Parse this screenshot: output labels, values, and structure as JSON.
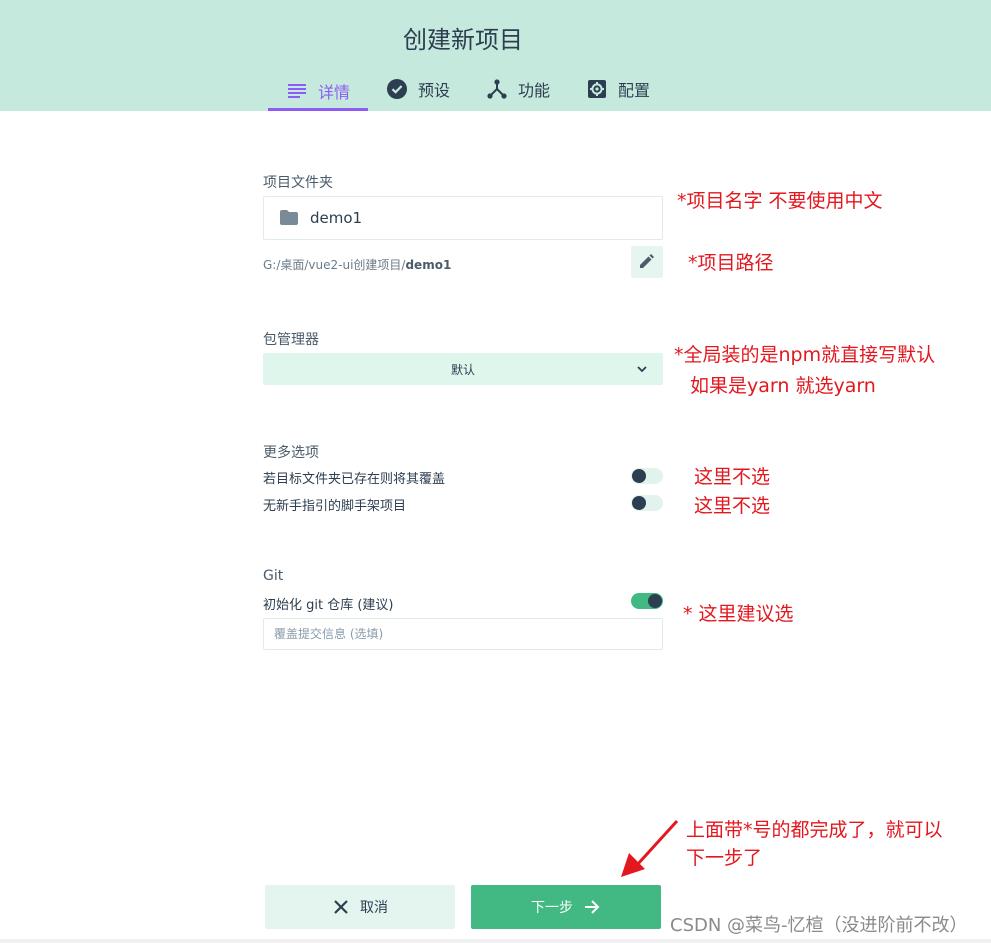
{
  "header": {
    "title": "创建新项目",
    "tabs": [
      {
        "label": "详情",
        "icon": "list-icon",
        "active": true
      },
      {
        "label": "预设",
        "icon": "check-circle-icon",
        "active": false
      },
      {
        "label": "功能",
        "icon": "branch-icon",
        "active": false
      },
      {
        "label": "配置",
        "icon": "gear-icon",
        "active": false
      }
    ]
  },
  "folder": {
    "label": "项目文件夹",
    "value": "demo1",
    "path_prefix": "G:/桌面/vue2-ui创建项目/",
    "path_name": "demo1"
  },
  "package_manager": {
    "label": "包管理器",
    "selected": "默认"
  },
  "more_options": {
    "label": "更多选项",
    "items": [
      {
        "label": "若目标文件夹已存在则将其覆盖",
        "enabled": false
      },
      {
        "label": "无新手指引的脚手架项目",
        "enabled": false
      }
    ]
  },
  "git": {
    "label": "Git",
    "init_label": "初始化 git 仓库 (建议)",
    "init_enabled": true,
    "commit_placeholder": "覆盖提交信息 (选填)"
  },
  "annotations": {
    "name_note": "*项目名字 不要使用中文",
    "path_note": "*项目路径",
    "pm_note_1": "*全局装的是npm就直接写默认",
    "pm_note_2": "如果是yarn 就选yarn",
    "opt1_note": "这里不选",
    "opt2_note": "这里不选",
    "git_note": "* 这里建议选",
    "final_note_1": "上面带*号的都完成了，就可以",
    "final_note_2": "下一步了"
  },
  "buttons": {
    "cancel": "取消",
    "next": "下一步"
  },
  "watermark": "CSDN @菜鸟-忆楦（没进阶前不改）",
  "colors": {
    "header_bg": "#c6e9dd",
    "accent_purple": "#8d5cf6",
    "primary_green": "#42b983",
    "annotation_red": "#e3171e"
  }
}
